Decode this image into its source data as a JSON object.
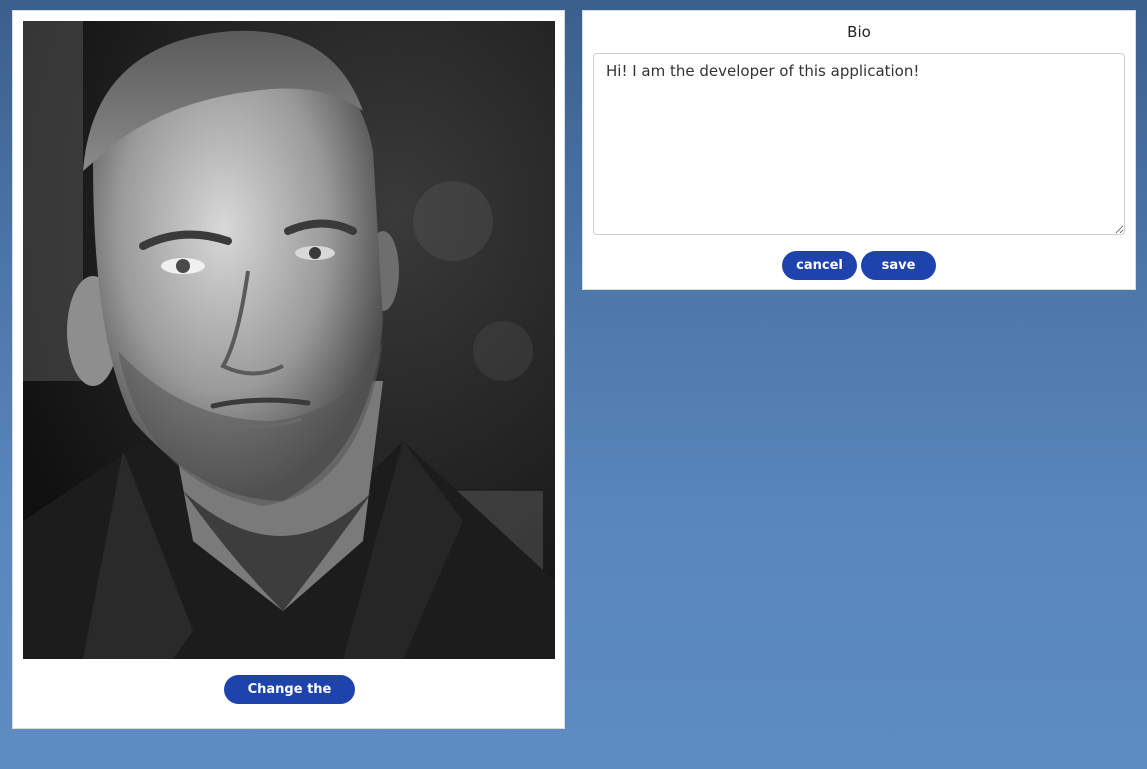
{
  "profile": {
    "image_alt": "Black and white portrait photo",
    "change_image_label": "Change the image"
  },
  "bio": {
    "title": "Bio",
    "text": "Hi! I am the developer of this application!",
    "cancel_label": "cancel",
    "save_label": "save"
  },
  "colors": {
    "button": "#1e43ad",
    "background_top": "#3b5f8d",
    "background_bottom": "#5d8cc1"
  }
}
